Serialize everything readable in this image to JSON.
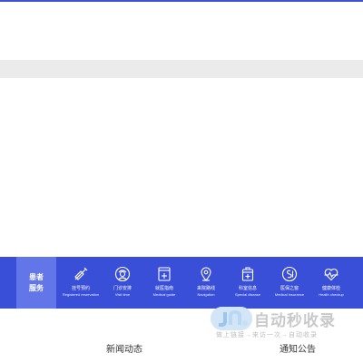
{
  "patient_services": {
    "title_line1": "患者",
    "title_line2": "服务",
    "items": [
      {
        "icon": "syringe-icon",
        "label_cn": "挂号预约",
        "label_en": "Registered reservation"
      },
      {
        "icon": "doctor-icon",
        "label_cn": "门诊安排",
        "label_en": "Visit time"
      },
      {
        "icon": "medical-guide-icon",
        "label_cn": "就医指南",
        "label_en": "Medical guide"
      },
      {
        "icon": "location-pin-icon",
        "label_cn": "来院路线",
        "label_en": "Navigation"
      },
      {
        "icon": "special-disease-icon",
        "label_cn": "科室信息",
        "label_en": "Special disease"
      },
      {
        "icon": "medical-insurance-icon",
        "label_cn": "医保之窗",
        "label_en": "Medical insurance"
      },
      {
        "icon": "heart-checkup-icon",
        "label_cn": "健康体检",
        "label_en": "Health checkup"
      }
    ]
  },
  "sections": {
    "news": "新闻动态",
    "notice": "通知公告"
  },
  "watermark": {
    "title": "自动秒收录",
    "subtitle": "做上链接→来访一次→自动收录"
  }
}
